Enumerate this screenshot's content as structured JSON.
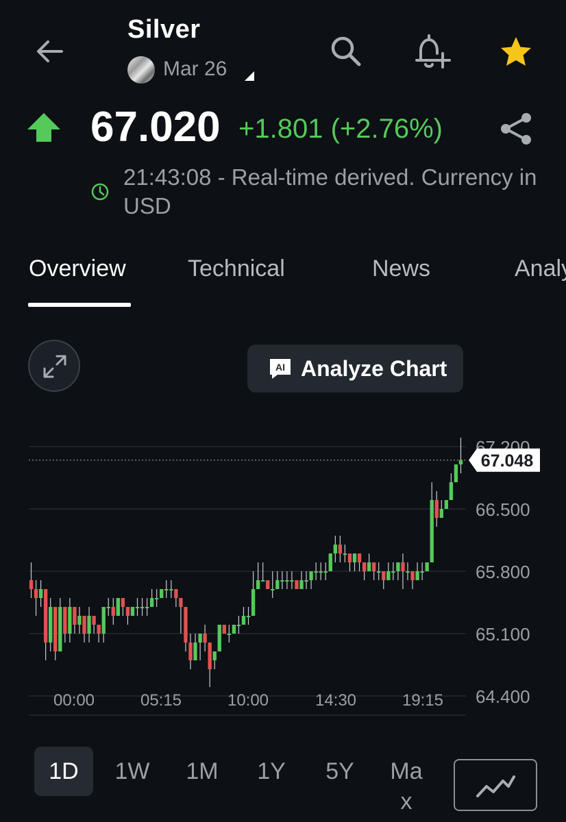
{
  "header": {
    "title": "Silver",
    "contract": "Mar 26"
  },
  "quote": {
    "price": "67.020",
    "change": "+1.801 (+2.76%)",
    "timestamp": "21:43:08 - Real-time derived. Currency in USD",
    "up_color": "#55c95a"
  },
  "tabs": [
    {
      "label": "Overview",
      "active": true
    },
    {
      "label": "Technical"
    },
    {
      "label": "News"
    },
    {
      "label": "Analy"
    }
  ],
  "chart_controls": {
    "analyze_label": "Analyze Chart",
    "analyze_icon_text": "AI"
  },
  "chart_data": {
    "type": "candlestick",
    "x_tick_labels": [
      "00:00",
      "05:15",
      "10:00",
      "14:30",
      "19:15"
    ],
    "y_ticks": [
      64.4,
      65.1,
      65.8,
      66.5,
      67.2
    ],
    "y_tick_labels": [
      "64.400",
      "65.100",
      "65.800",
      "66.500",
      "67.200"
    ],
    "ylim": [
      64.4,
      67.2
    ],
    "current_price": 67.048,
    "current_price_label": "67.048",
    "up_color": "#55c95a",
    "down_color": "#e05252",
    "candles": [
      [
        65.7,
        65.6,
        65.9,
        65.5
      ],
      [
        65.6,
        65.5,
        65.7,
        65.3
      ],
      [
        65.5,
        65.6,
        65.7,
        65.4
      ],
      [
        65.6,
        65.0,
        65.6,
        64.8
      ],
      [
        65.0,
        65.4,
        65.5,
        64.9
      ],
      [
        65.4,
        64.9,
        65.4,
        64.8
      ],
      [
        64.9,
        65.4,
        65.5,
        64.9
      ],
      [
        65.4,
        65.1,
        65.4,
        65.0
      ],
      [
        65.1,
        65.4,
        65.5,
        65.0
      ],
      [
        65.4,
        65.2,
        65.4,
        65.1
      ],
      [
        65.2,
        65.3,
        65.4,
        65.1
      ],
      [
        65.3,
        65.1,
        65.3,
        65.0
      ],
      [
        65.1,
        65.3,
        65.4,
        65.0
      ],
      [
        65.3,
        65.2,
        65.3,
        65.1
      ],
      [
        65.2,
        65.1,
        65.2,
        65.0
      ],
      [
        65.1,
        65.4,
        65.4,
        65.0
      ],
      [
        65.4,
        65.4,
        65.5,
        65.3
      ],
      [
        65.4,
        65.3,
        65.5,
        65.2
      ],
      [
        65.3,
        65.5,
        65.5,
        65.3
      ],
      [
        65.5,
        65.4,
        65.5,
        65.3
      ],
      [
        65.4,
        65.3,
        65.4,
        65.2
      ],
      [
        65.3,
        65.4,
        65.4,
        65.3
      ],
      [
        65.4,
        65.4,
        65.5,
        65.3
      ],
      [
        65.4,
        65.4,
        65.5,
        65.3
      ],
      [
        65.4,
        65.4,
        65.5,
        65.3
      ],
      [
        65.4,
        65.5,
        65.6,
        65.4
      ],
      [
        65.5,
        65.5,
        65.6,
        65.4
      ],
      [
        65.5,
        65.6,
        65.6,
        65.5
      ],
      [
        65.6,
        65.6,
        65.7,
        65.5
      ],
      [
        65.6,
        65.6,
        65.7,
        65.5
      ],
      [
        65.6,
        65.5,
        65.6,
        65.4
      ],
      [
        65.5,
        65.4,
        65.5,
        65.1
      ],
      [
        65.4,
        65.0,
        65.4,
        64.9
      ],
      [
        65.0,
        64.8,
        65.1,
        64.7
      ],
      [
        64.8,
        65.0,
        65.1,
        64.8
      ],
      [
        65.0,
        65.1,
        65.1,
        64.8
      ],
      [
        65.1,
        65.0,
        65.2,
        64.9
      ],
      [
        65.0,
        64.7,
        65.0,
        64.5
      ],
      [
        64.8,
        64.9,
        64.9,
        64.7
      ],
      [
        64.9,
        65.2,
        65.2,
        64.9
      ],
      [
        65.2,
        65.1,
        65.2,
        65.1
      ],
      [
        65.1,
        65.1,
        65.2,
        65.0
      ],
      [
        65.1,
        65.2,
        65.2,
        65.1
      ],
      [
        65.2,
        65.2,
        65.3,
        65.1
      ],
      [
        65.2,
        65.3,
        65.4,
        65.2
      ],
      [
        65.3,
        65.3,
        65.4,
        65.2
      ],
      [
        65.3,
        65.6,
        65.8,
        65.3
      ],
      [
        65.6,
        65.7,
        65.9,
        65.6
      ],
      [
        65.7,
        65.7,
        65.9,
        65.7
      ],
      [
        65.7,
        65.6,
        65.7,
        65.6
      ],
      [
        65.6,
        65.6,
        65.8,
        65.5
      ],
      [
        65.6,
        65.7,
        65.8,
        65.6
      ],
      [
        65.7,
        65.7,
        65.8,
        65.6
      ],
      [
        65.7,
        65.7,
        65.8,
        65.6
      ],
      [
        65.7,
        65.7,
        65.8,
        65.6
      ],
      [
        65.7,
        65.6,
        65.7,
        65.6
      ],
      [
        65.6,
        65.7,
        65.8,
        65.6
      ],
      [
        65.7,
        65.7,
        65.8,
        65.6
      ],
      [
        65.7,
        65.8,
        65.8,
        65.6
      ],
      [
        65.8,
        65.8,
        65.9,
        65.7
      ],
      [
        65.8,
        65.8,
        65.9,
        65.7
      ],
      [
        65.8,
        65.8,
        65.9,
        65.7
      ],
      [
        65.8,
        66.0,
        66.0,
        65.8
      ],
      [
        66.0,
        66.1,
        66.2,
        65.9
      ],
      [
        66.1,
        66.0,
        66.2,
        65.9
      ],
      [
        66.0,
        66.0,
        66.1,
        65.9
      ],
      [
        66.0,
        65.9,
        66.0,
        65.8
      ],
      [
        65.9,
        66.0,
        66.0,
        65.8
      ],
      [
        66.0,
        65.9,
        66.0,
        65.8
      ],
      [
        65.9,
        65.8,
        65.9,
        65.7
      ],
      [
        65.8,
        65.9,
        66.0,
        65.8
      ],
      [
        65.9,
        65.8,
        65.9,
        65.7
      ],
      [
        65.8,
        65.8,
        65.9,
        65.7
      ],
      [
        65.8,
        65.7,
        65.8,
        65.6
      ],
      [
        65.7,
        65.8,
        65.9,
        65.7
      ],
      [
        65.8,
        65.8,
        65.9,
        65.7
      ],
      [
        65.8,
        65.9,
        65.9,
        65.7
      ],
      [
        65.9,
        65.8,
        66.0,
        65.6
      ],
      [
        65.8,
        65.8,
        65.9,
        65.7
      ],
      [
        65.8,
        65.7,
        65.8,
        65.6
      ],
      [
        65.7,
        65.8,
        65.9,
        65.7
      ],
      [
        65.8,
        65.8,
        65.9,
        65.7
      ],
      [
        65.8,
        65.9,
        65.9,
        65.8
      ],
      [
        65.9,
        66.6,
        66.8,
        65.9
      ],
      [
        66.6,
        66.4,
        66.7,
        66.3
      ],
      [
        66.4,
        66.5,
        66.6,
        66.4
      ],
      [
        66.5,
        66.6,
        66.6,
        66.5
      ],
      [
        66.6,
        66.8,
        66.9,
        66.6
      ],
      [
        66.8,
        67.0,
        67.0,
        66.8
      ],
      [
        67.0,
        67.05,
        67.3,
        66.9
      ]
    ]
  },
  "ranges": [
    {
      "label": "1D",
      "active": true
    },
    {
      "label": "1W"
    },
    {
      "label": "1M"
    },
    {
      "label": "1Y"
    },
    {
      "label": "5Y"
    },
    {
      "label": "Max"
    }
  ]
}
